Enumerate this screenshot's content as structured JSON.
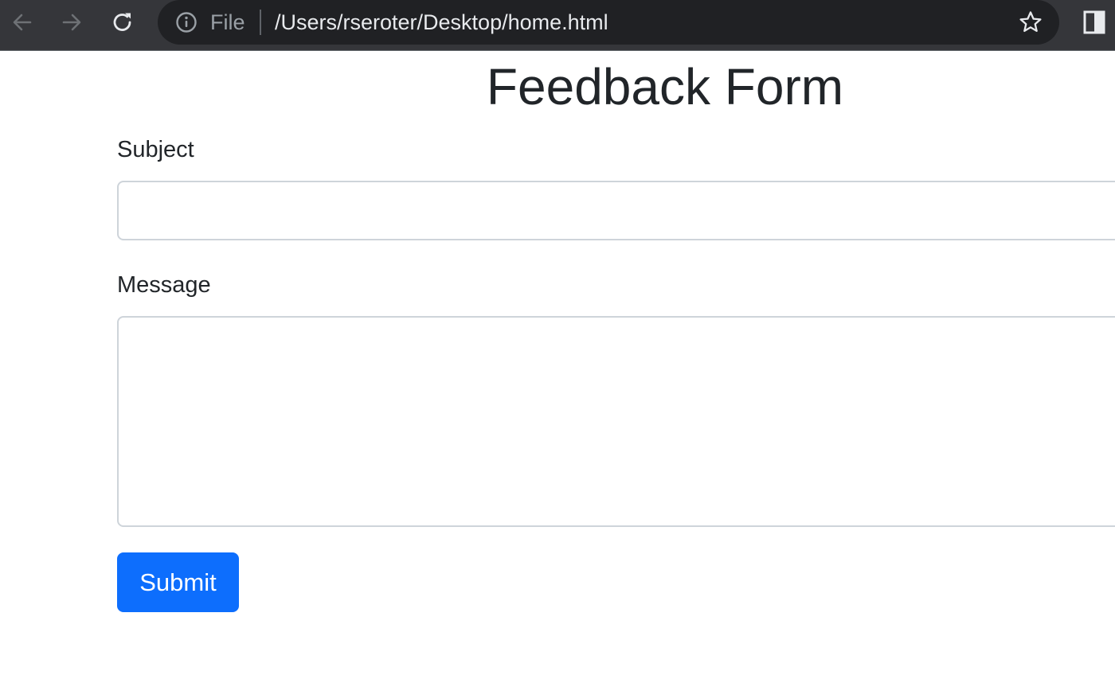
{
  "browser": {
    "scheme_label": "File",
    "url": "/Users/rseroter/Desktop/home.html",
    "icons": {
      "back": "back-arrow-icon",
      "forward": "forward-arrow-icon",
      "reload": "reload-icon",
      "info": "info-icon",
      "bookmark": "star-icon",
      "side_panel": "side-panel-icon"
    },
    "colors": {
      "toolbar": "#35363a",
      "omnibox": "#202124",
      "url_text": "#e8eaed",
      "muted_text": "#9aa0a6"
    }
  },
  "page": {
    "title": "Feedback Form",
    "subject": {
      "label": "Subject",
      "value": "",
      "placeholder": ""
    },
    "message": {
      "label": "Message",
      "value": "",
      "placeholder": ""
    },
    "submit_label": "Submit",
    "colors": {
      "text": "#212529",
      "primary": "#0d6efd",
      "input_border": "#ced4da"
    }
  }
}
